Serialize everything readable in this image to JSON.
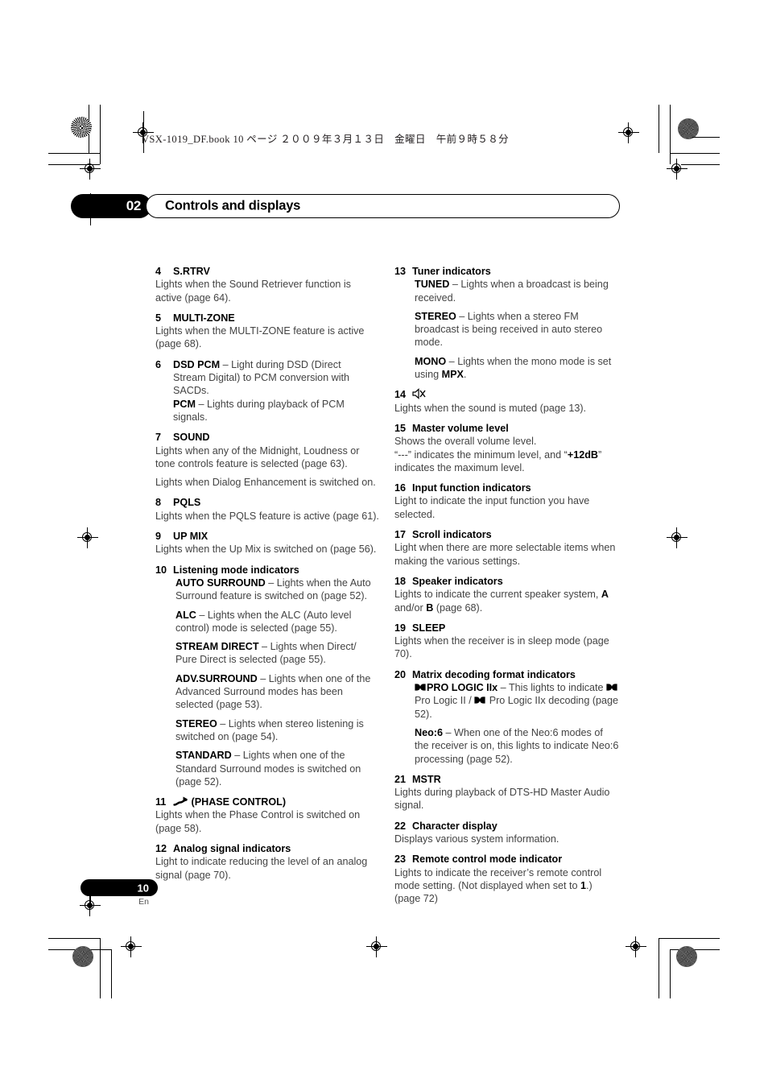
{
  "book_header": "VSX-1019_DF.book   10 ページ   ２００９年３月１３日　金曜日　午前９時５８分",
  "chapter": {
    "number": "02",
    "title": "Controls and displays"
  },
  "footer": {
    "page_number": "10",
    "language": "En"
  },
  "icons": {
    "mute": "mute-icon",
    "phase_control": "phase-control-icon",
    "dolby": "dolby-double-d-icon"
  },
  "left_column": [
    {
      "num": "4",
      "label": "S.RTRV",
      "body": [
        "Lights when the Sound Retriever function is active (page 64)."
      ]
    },
    {
      "num": "5",
      "label": "MULTI-ZONE",
      "body": [
        "Lights when the MULTI-ZONE feature is active (page 68)."
      ]
    },
    {
      "num": "6",
      "hanging": true,
      "lines": [
        {
          "bold": "DSD PCM",
          "rest": " – Light during DSD (Direct Stream Digital) to PCM conversion with SACDs."
        },
        {
          "bold": "PCM",
          "rest": " – Lights during playback of PCM signals."
        }
      ]
    },
    {
      "num": "7",
      "label": "SOUND",
      "body": [
        "Lights when any of the Midnight, Loudness or tone controls feature is selected (page 63).",
        "Lights when Dialog Enhancement is switched on."
      ]
    },
    {
      "num": "8",
      "label": "PQLS",
      "body": [
        "Lights when the PQLS feature is active (page 61)."
      ]
    },
    {
      "num": "9",
      "label": "UP MIX",
      "body": [
        "Lights when the Up Mix is switched on (page 56)."
      ]
    },
    {
      "num": "10",
      "label": "Listening mode indicators",
      "sub": [
        {
          "bold": "AUTO SURROUND",
          "rest": " – Lights when the Auto Surround feature is switched on (page 52)."
        },
        {
          "bold": "ALC",
          "rest": " – Lights when the ALC (Auto level control) mode is selected (page 55)."
        },
        {
          "bold": "STREAM DIRECT",
          "rest": " – Lights when Direct/ Pure Direct is selected (page 55)."
        },
        {
          "bold": "ADV.SURROUND",
          "rest": " – Lights when one of the Advanced Surround modes has been selected (page 53)."
        },
        {
          "bold": "STEREO",
          "rest": " – Lights when stereo listening is switched on (page 54)."
        },
        {
          "bold": "STANDARD",
          "rest": " – Lights when one of the Standard Surround modes is switched on (page 52)."
        }
      ]
    },
    {
      "num": "11",
      "icon": "phase-control-icon",
      "label": "(PHASE CONTROL)",
      "body": [
        "Lights when the Phase Control is switched on (page 58)."
      ]
    },
    {
      "num": "12",
      "label": "Analog signal indicators",
      "body": [
        "Light to indicate reducing the level of an analog signal (page 70)."
      ]
    }
  ],
  "right_column": [
    {
      "num": "13",
      "label": "Tuner indicators",
      "sub": [
        {
          "bold": "TUNED",
          "rest": " – Lights when a broadcast is being received."
        },
        {
          "bold": "STEREO",
          "rest": " – Lights when a stereo FM broadcast is being received in auto stereo mode."
        },
        {
          "bold": "MONO",
          "rest": " – Lights when the mono mode is set using ",
          "bold_tail": "MPX",
          "tail": "."
        }
      ]
    },
    {
      "num": "14",
      "icon": "mute-icon",
      "label": "",
      "body": [
        "Lights when the sound is muted (page 13)."
      ]
    },
    {
      "num": "15",
      "label": "Master volume level",
      "body": [
        "Shows the overall volume level."
      ],
      "rich_body": {
        "pre": "“---” indicates the minimum level, and “",
        "bold": "+12dB",
        "post": "” indicates the maximum level."
      }
    },
    {
      "num": "16",
      "label": "Input function indicators",
      "body": [
        "Light to indicate the input function you have selected."
      ]
    },
    {
      "num": "17",
      "label": "Scroll indicators",
      "body": [
        "Light when there are more selectable items when making the various settings."
      ]
    },
    {
      "num": "18",
      "label": "Speaker indicators",
      "rich_body": {
        "pre": "Lights to indicate the current speaker system, ",
        "bold": "A",
        "mid": " and/or ",
        "bold2": "B",
        "post": " (page 68)."
      }
    },
    {
      "num": "19",
      "label": "SLEEP",
      "body": [
        "Lights when the receiver is in sleep mode (page 70)."
      ]
    },
    {
      "num": "20",
      "label": "Matrix decoding format indicators",
      "sub": [
        {
          "dolby": true,
          "bold": "PRO LOGIC IIx",
          "rest": " – This lights to indicate ",
          "dolby_inline": true,
          "rest2": " Pro Logic II / ",
          "rest3": " Pro Logic IIx decoding (page 52)."
        },
        {
          "bold": "Neo:6",
          "rest": " – When one of the Neo:6 modes of the receiver is on, this lights to indicate Neo:6 processing (page 52)."
        }
      ]
    },
    {
      "num": "21",
      "label": "MSTR",
      "body": [
        "Lights during playback of DTS-HD Master Audio signal."
      ]
    },
    {
      "num": "22",
      "label": "Character display",
      "body": [
        "Displays various system information."
      ]
    },
    {
      "num": "23",
      "label": "Remote control mode indicator",
      "rich_body": {
        "pre": "Lights to indicate the receiver’s remote control mode setting. (Not displayed when set to ",
        "bold": "1",
        "post": ".) (page 72)"
      }
    }
  ]
}
